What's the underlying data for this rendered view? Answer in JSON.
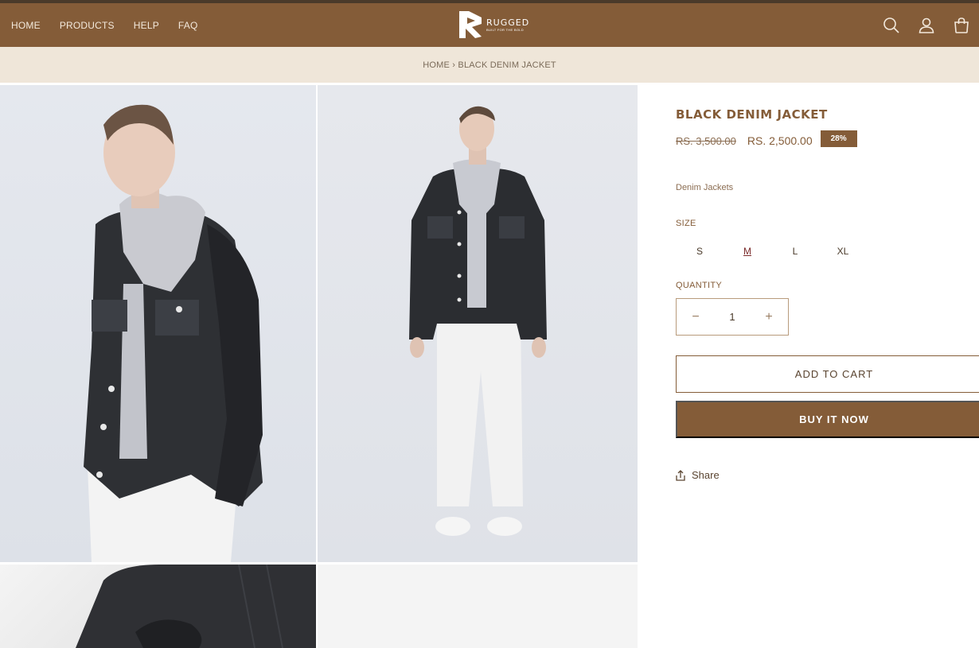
{
  "header": {
    "nav": [
      "HOME",
      "PRODUCTS",
      "HELP",
      "FAQ"
    ],
    "logo_name": "RUGGED",
    "logo_tagline": "BUILT FOR THE BOLD",
    "icons": [
      "search-icon",
      "account-icon",
      "cart-icon"
    ],
    "bg_color": "#845c38"
  },
  "breadcrumb": {
    "home": "HOME",
    "separator": "›",
    "current": "BLACK DENIM JACKET"
  },
  "product": {
    "title": "BLACK DENIM JACKET",
    "old_price": "RS. 3,500.00",
    "new_price": "RS. 2,500.00",
    "discount_badge": "28%",
    "category": "Denim Jackets",
    "size_label": "SIZE",
    "sizes": [
      "S",
      "M",
      "L",
      "XL"
    ],
    "selected_size": "M",
    "quantity_label": "QUANTITY",
    "quantity": "1",
    "decrease_symbol": "−",
    "increase_symbol": "+",
    "add_to_cart": "ADD TO CART",
    "buy_now": "BUY IT NOW",
    "share": "Share",
    "accent_color": "#845c38"
  }
}
